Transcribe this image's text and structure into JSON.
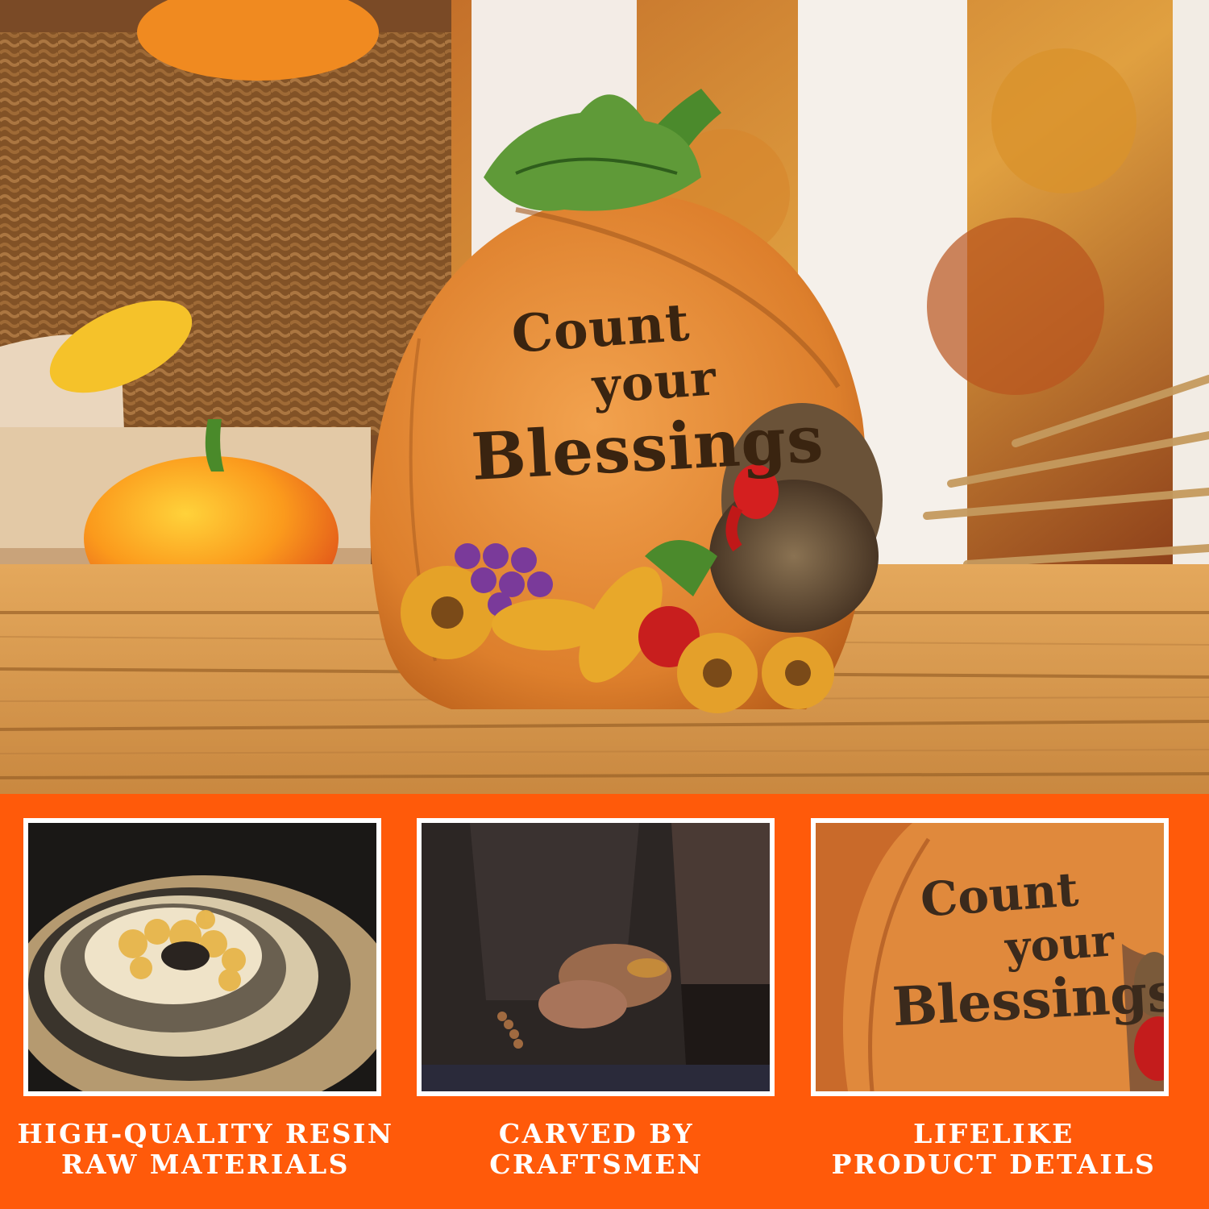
{
  "hero": {
    "sign": {
      "line1": "Count",
      "line2": "your",
      "line3": "Blessings"
    }
  },
  "features": [
    {
      "image": "resin-geode-photo",
      "caption_line1": "HIGH-QUALITY RESIN",
      "caption_line2": "RAW MATERIALS"
    },
    {
      "image": "craftsman-carving-photo",
      "caption_line1": "CARVED BY",
      "caption_line2": "CRAFTSMEN"
    },
    {
      "image": "sign-closeup-photo",
      "caption_line1": "LIFELIKE",
      "caption_line2": "PRODUCT DETAILS",
      "closeup_line1": "Count",
      "closeup_line2": "your",
      "closeup_line3": "Blessings"
    }
  ],
  "colors": {
    "band_background": "#ff5a0a",
    "frame_border": "#ffffff",
    "caption_text": "#ffffff",
    "pumpkin_orange": "#e0862f",
    "carved_text": "#3a2410"
  }
}
